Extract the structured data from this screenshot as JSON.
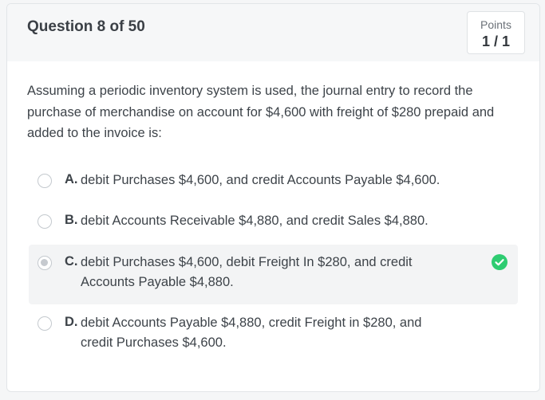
{
  "header": {
    "title": "Question 8 of 50",
    "points_label": "Points",
    "points_value": "1 / 1"
  },
  "question": {
    "text": "Assuming a periodic inventory system is used, the journal entry to record the purchase of merchandise on account for $4,600 with freight of $280 prepaid and added to the invoice is:"
  },
  "options": [
    {
      "letter": "A.",
      "text": "debit Purchases $4,600, and credit Accounts Payable $4,600.",
      "selected": false,
      "correct": false
    },
    {
      "letter": "B.",
      "text": "debit Accounts Receivable $4,880, and credit Sales $4,880.",
      "selected": false,
      "correct": false
    },
    {
      "letter": "C.",
      "text": "debit Purchases $4,600, debit Freight In $280, and credit Accounts Payable $4,880.",
      "selected": true,
      "correct": true
    },
    {
      "letter": "D.",
      "text": "debit Accounts Payable $4,880, credit Freight in $280, and credit Purchases $4,600.",
      "selected": false,
      "correct": false
    }
  ],
  "colors": {
    "correct": "#2ecc71",
    "selected_bg": "#f3f4f5"
  },
  "icons": {
    "correct": "check-circle-icon"
  }
}
